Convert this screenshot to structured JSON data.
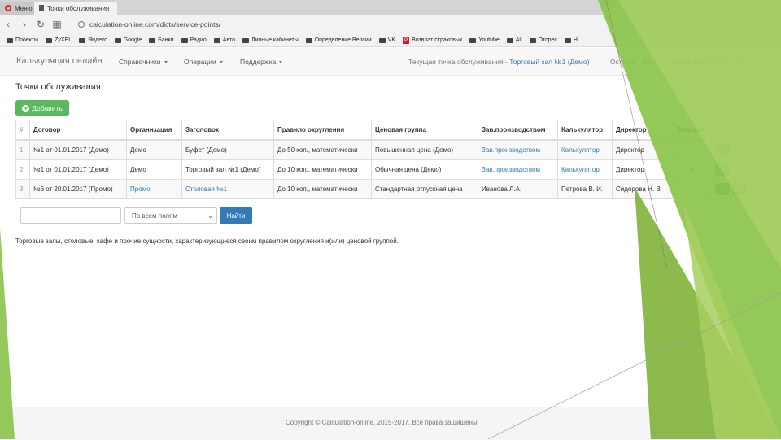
{
  "browser": {
    "tab_inactive": "Меню",
    "tab_active": "Точки обслуживания",
    "url": "calculation-online.com/dicts/service-points/",
    "minimize": "–",
    "maximize": "□",
    "close": "✕"
  },
  "bookmarks": [
    "Проекты",
    "ZyXEL",
    "Яндекс",
    "Google",
    "Банки",
    "Радио",
    "Авто",
    "Личные кабинеты",
    "Определение Версии",
    "VK",
    "Возврат страховых",
    "Youtube",
    "Ali",
    "Отсрес",
    "Н"
  ],
  "app": {
    "brand": "Калькуляция онлайн",
    "menu": [
      "Справочники",
      "Операции",
      "Поддержка"
    ],
    "current_point_label": "Текущая точка обслуживания -",
    "current_point_value": "Торговый зал №1 (Демо)",
    "balance": "Остаток - 0р.",
    "greeting": "Привет,",
    "user_name": "Елена Будылко"
  },
  "page": {
    "title": "Точки обслуживания",
    "add_label": "Добавить",
    "columns": [
      "#",
      "Договор",
      "Организация",
      "Заголовок",
      "Правило округления",
      "Ценовая группа",
      "Зав.производством",
      "Калькулятор",
      "Директор",
      "Текущая",
      ""
    ],
    "rows": [
      {
        "num": "1",
        "contract": "№1 от 01.01.2017 (Демо)",
        "org": "Демо",
        "title": "Буфет (Демо)",
        "rounding": "До 50 коп., математически",
        "price_group": "Повышенная цена (Демо)",
        "manager": "Зав.производством",
        "calculator": "Калькулятор",
        "director": "Директор",
        "current": ""
      },
      {
        "num": "2",
        "contract": "№1 от 01.01.2017 (Демо)",
        "org": "Демо",
        "title": "Торговый зал №1 (Демо)",
        "rounding": "До 10 коп., математически",
        "price_group": "Обычная цена (Демо)",
        "manager": "Зав.производством",
        "calculator": "Калькулятор",
        "director": "Директор",
        "current": "✔"
      },
      {
        "num": "3",
        "contract": "№6 от 20.01.2017 (Промо)",
        "org": "Промо",
        "title": "Столовая №1",
        "rounding": "До 10 коп., математически",
        "price_group": "Стандартная отпускная цена",
        "manager": "Иванова Л.А.",
        "calculator": "Петрова В. И.",
        "director": "Сидорова Н. В.",
        "current": ""
      }
    ],
    "search_placeholder": "",
    "search_field_option": "По всем полям",
    "find_label": "Найти",
    "description": "Торговые залы, столовые, кафе и прочие сущности, характеризующиеся своим правилом округления и(или) ценовой группой."
  },
  "footer": {
    "copyright": "Copyright © Calculation-online. 2015-2017, Все права защищены"
  },
  "colors": {
    "success": "#5cb85c",
    "primary": "#337ab7",
    "info": "#5bc0de",
    "warning": "#f0ad4e",
    "decor_green": "#8bc34a"
  }
}
